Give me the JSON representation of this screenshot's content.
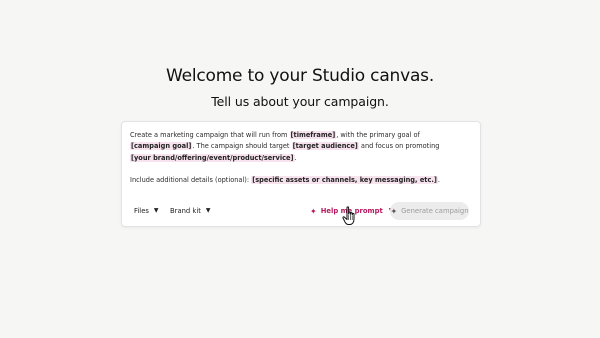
{
  "header": {
    "title": "Welcome to your Studio canvas.",
    "subtitle": "Tell us about your campaign."
  },
  "prompt": {
    "line1_a": "Create a marketing campaign that will run from ",
    "timeframe": "[timeframe]",
    "line1_b": ", with the primary goal of ",
    "campaign_goal": "[campaign goal]",
    "line1_c": ". The campaign should target ",
    "target_audience": "[target audience]",
    "line1_d": " and focus on promoting ",
    "brand_offering": "[your brand/offering/event/product/service]",
    "line1_e": ".",
    "line2_a": "Include additional details (optional): ",
    "details": "[specific assets or channels, key messaging, etc.]",
    "line2_b": "."
  },
  "toolbar": {
    "files_label": "Files",
    "brand_kit_label": "Brand kit",
    "help_label": "Help me prompt",
    "generate_label": "Generate campaign"
  },
  "icons": {
    "help_icon": "sparkle-icon",
    "generate_icon": "sparkle-icon",
    "pointer": "hand-pointer-cursor"
  },
  "colors": {
    "accent": "#b8185f",
    "placeholder_highlight": "#f7e3ee",
    "background": "#f6f6f4",
    "generate_disabled_bg": "#ececec"
  }
}
